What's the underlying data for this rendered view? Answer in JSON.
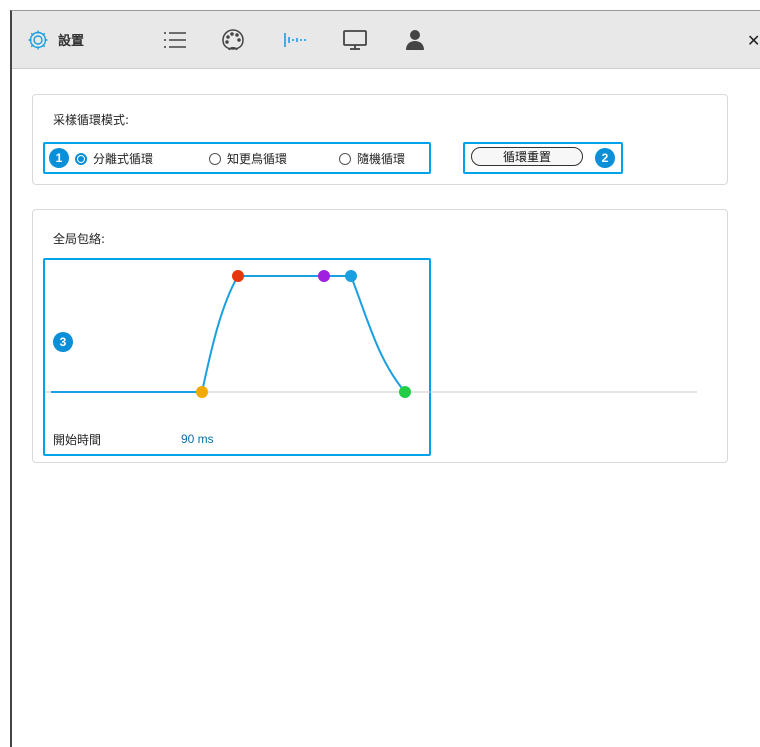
{
  "toolbar": {
    "title": "設置",
    "icons": [
      "gear-icon",
      "list-icon",
      "palette-icon",
      "waveform-icon",
      "monitor-icon",
      "user-icon",
      "close-icon"
    ],
    "accent": "#1aa0e0",
    "close_glyph": "✕"
  },
  "loop_mode": {
    "title": "采樣循環模式:",
    "badge1": "1",
    "options": [
      {
        "label": "分離式循環",
        "selected": true
      },
      {
        "label": "知更鳥循環",
        "selected": false
      },
      {
        "label": "隨機循環",
        "selected": false
      }
    ],
    "reset_label": "循環重置",
    "badge2": "2"
  },
  "envelope": {
    "title": "全局包絡:",
    "badge3": "3",
    "start_label": "開始時間",
    "start_value": "90 ms",
    "point_colors": [
      "#f2a900",
      "#e8350e",
      "#a020e0",
      "#1aa0e0",
      "#22cc44"
    ],
    "curve_color": "#1aa0e0"
  }
}
